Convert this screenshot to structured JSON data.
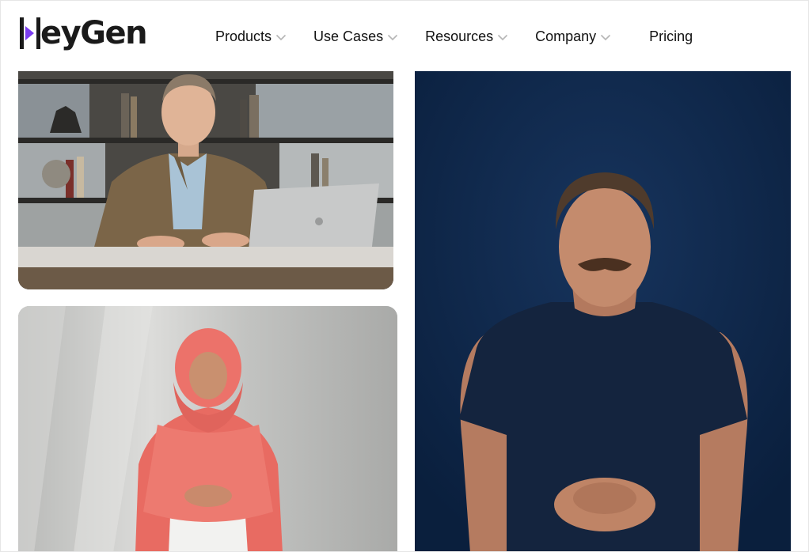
{
  "brand": {
    "name": "HeyGen",
    "logo_text": "eyGen",
    "accent_color": "#7b3df0"
  },
  "nav": {
    "items": [
      {
        "label": "Products",
        "has_dropdown": true
      },
      {
        "label": "Use Cases",
        "has_dropdown": true
      },
      {
        "label": "Resources",
        "has_dropdown": true
      },
      {
        "label": "Company",
        "has_dropdown": true
      }
    ],
    "pricing_label": "Pricing"
  },
  "media": {
    "cards": [
      {
        "subject": "man-at-desk-with-laptop",
        "background_color": "#3b3a37"
      },
      {
        "subject": "woman-in-coral-hijab",
        "background_color": "#c7c8c6"
      },
      {
        "subject": "man-with-mustache-navy-shirt",
        "background_color": "#0c2446"
      }
    ]
  }
}
